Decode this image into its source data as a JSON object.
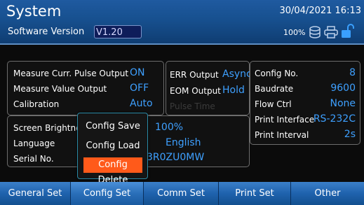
{
  "header": {
    "title": "System",
    "version_label": "Software Version",
    "version_value": "V1.20",
    "datetime": "30/04/2021 16:13",
    "battery": "100%",
    "icons": [
      "disk-icon",
      "printer-icon",
      "lock-icon"
    ]
  },
  "measure_panel": {
    "rows": [
      {
        "label": "Measure Curr. Pulse Output",
        "value": "ON"
      },
      {
        "label": "Measure Value Output",
        "value": "OFF"
      },
      {
        "label": "Calibration",
        "value": "Auto"
      }
    ]
  },
  "output_panel": {
    "rows": [
      {
        "label": "ERR Output",
        "value": "Async"
      },
      {
        "label": "EOM Output",
        "value": "Hold"
      },
      {
        "label": "Pulse Time",
        "value": ""
      }
    ]
  },
  "comm_panel": {
    "rows": [
      {
        "label": "Config No.",
        "value": "8"
      },
      {
        "label": "Baudrate",
        "value": "9600"
      },
      {
        "label": "Flow Ctrl",
        "value": "None"
      },
      {
        "label": "Print Interface",
        "value": "RS-232C"
      },
      {
        "label": "Print Interval",
        "value": "2s"
      }
    ]
  },
  "general_panel": {
    "rows": [
      {
        "label": "Screen Brightne",
        "value": "100%"
      },
      {
        "label": "Language",
        "value": "English"
      },
      {
        "label": "Serial No.",
        "value": "3R0ZU0MW"
      }
    ]
  },
  "popup": {
    "items": [
      "Config Save",
      "Config Load",
      "Config Delete"
    ],
    "selected_index": 2
  },
  "tabs": [
    "General Set",
    "Config Set",
    "Comm Set",
    "Print Set",
    "Other"
  ],
  "colors": {
    "accent": "#3ea0ff",
    "header": "#17508f",
    "highlight": "#ff5a1a"
  }
}
